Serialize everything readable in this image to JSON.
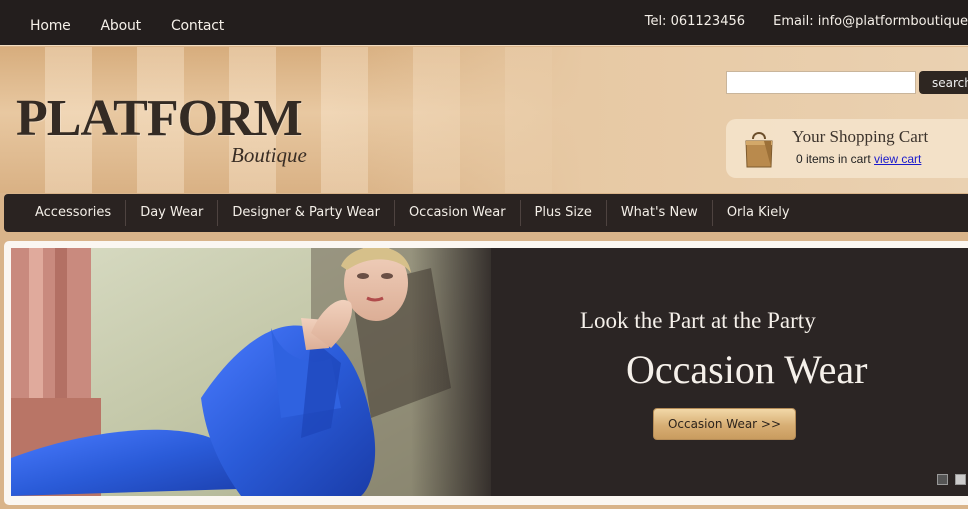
{
  "topbar": {
    "nav": [
      "Home",
      "About",
      "Contact"
    ],
    "tel": "Tel: 061123456",
    "email": "Email:  info@platformboutique"
  },
  "header": {
    "logo_main": "PLATFORM",
    "logo_sub": "Boutique",
    "search": {
      "value": "",
      "button": "search"
    },
    "cart": {
      "title": "Your Shopping Cart",
      "items_text": "0 items in cart",
      "link": "view cart"
    }
  },
  "mainnav": [
    "Accessories",
    "Day Wear",
    "Designer & Party Wear",
    "Occasion Wear",
    "Plus Size",
    "What's New",
    "Orla Kiely"
  ],
  "banner": {
    "tagline": "Look the Part at the Party",
    "headline": "Occasion Wear",
    "cta": "Occasion Wear >>",
    "slides": 2,
    "active_slide": 1
  },
  "colors": {
    "dark": "#231e1d",
    "header_tan": "#e3c29b",
    "cta_gold": "#d7ae74",
    "dress_blue": "#2a5bd8"
  }
}
